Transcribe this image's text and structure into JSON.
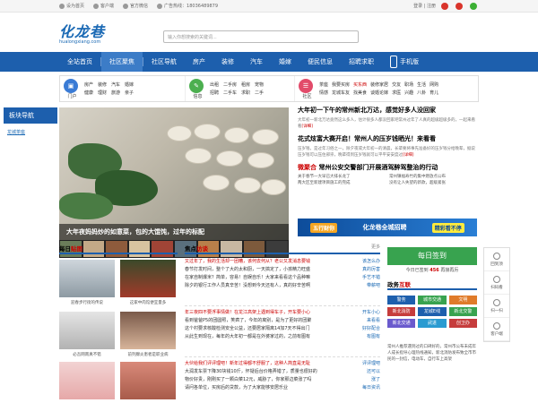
{
  "topbar": {
    "set_home": "设为首页",
    "client": "客户端",
    "wechat": "官方微信",
    "ad_hotline": "广告热线：18036489879",
    "login": "登录 | 注册"
  },
  "header": {
    "logo_text": "化龙巷",
    "logo_sub": "hualongxiang.com",
    "search_placeholder": "输入你想搜索的关键词..."
  },
  "nav": {
    "items": [
      "全站首页",
      "社区聚焦",
      "社区导航",
      "房产",
      "装修",
      "汽车",
      "婚嫁",
      "便民信息",
      "招聘求职",
      "手机版"
    ]
  },
  "categories": {
    "menhu": {
      "label": "门户",
      "links": [
        "房产",
        "装修",
        "汽车",
        "婚嫁",
        "健康",
        "理财",
        "旅游",
        "亲子"
      ]
    },
    "xinxi": {
      "label": "信息",
      "links": [
        "出租",
        "二手房",
        "租房",
        "宠物",
        "招聘",
        "二手车",
        "求职",
        "二手"
      ]
    },
    "shequ": {
      "label": "社区",
      "links": [
        "茶座",
        "我要买房",
        "买东西",
        "装修家居",
        "交友",
        "职场",
        "生活",
        "网购",
        "情感",
        "龙城车友",
        "找美食",
        "谈婚论嫁",
        "求医",
        "兴趣",
        "八卦",
        "育儿"
      ]
    }
  },
  "sidebar": {
    "title": "板块导航",
    "link": "龙城茶座"
  },
  "feature": {
    "caption": "大年夜妈妈炒的如意菜，包的大馄饨，过年的标配"
  },
  "news": {
    "headline1": "大年初一下午的常州新北万达，感觉好多人没回家",
    "para1": "大年初一新北万达竟然这么多人，估计很多人都没回家吧常州过年了人真的超级超级多的，一起来看看",
    "detail1": "[详细]",
    "headline2": "花式炫富大赛开启！常州人的压岁钱晒光！来看看",
    "para2": "压岁钱，是过年习俗之一，除夕夜或大年初一的清晨，长辈要将事先准备好的压岁钱分给晚辈，据说压岁钱可以压住邪祟，晚辈得到压岁钱就可以平平安安度过",
    "detail2": "[详细]",
    "tag3": "微聚合",
    "headline3": "常州公安交警部门开展酒驾醉驾整治的行动",
    "sub": [
      "关于春节一大早已大排长龙了",
      "常州镇福寿竹的集中燃放点公布",
      "两大区至新建项目施工的完成",
      "没有让人失望的新款，超级紧张"
    ]
  },
  "banner": {
    "left": "五行财你",
    "mid": "化龙巷全城招聘",
    "right": "精彩看不停"
  },
  "daily_photo": {
    "title_prefix": "每日",
    "title_hl": "贴图",
    "items": [
      {
        "caption": "迎春步行街的传说"
      },
      {
        "caption": "这家中肉馆便宜量多"
      },
      {
        "caption": "必吾网南真不错"
      },
      {
        "caption": "前列腺炎患者是职业病"
      }
    ]
  },
  "focus": {
    "title_prefix": "焦点",
    "title_hl": "访谈",
    "more": "更多",
    "groups": [
      [
        {
          "text": "又过年了，我的生活却一团糟，该何去何从？老公又发消息要钱",
          "right": "该怎么办",
          "red": true
        },
        {
          "text": "春节打发时间，整个了大的太和厨，一天搞定了，小孩精力旺盛",
          "right": "真的厉害"
        },
        {
          "text": "在家自制爆米？简单，容易！自娱自乐！大家来看看这个品种嘛",
          "right": "手艺不错"
        },
        {
          "text": "除夕的银行工作人员真辛苦！没想到今天还有人，真的好辛苦啊",
          "right": "带薪吧"
        }
      ],
      [
        {
          "text": "年三夜四不要浮事情做！在龙江高架上遇到得车子，开车要小心",
          "right": "开车小心",
          "red": true
        },
        {
          "text": "看到爸爸P5的团圆照，笑疯了，今年的离别，是为了更好的团聚",
          "right": "来看看"
        },
        {
          "text": "这个村要求核酸检测安全公益，还要居家隔离14加7天不得出门",
          "right": "好好配合"
        },
        {
          "text": "从此生到现在，每年的大年初一都是在外婆家过的，之前有图有",
          "right": "有图有"
        }
      ],
      [
        {
          "text": "大伙给我们评评理吧！新年过得都不舒服了，这种人简直是无耻",
          "right": "评评理吧",
          "red": true
        },
        {
          "text": "大润发车票下降30块钱10斤，怀疑后台价格弄错了，质量也很好的",
          "right": "还可以"
        },
        {
          "text": "物价好贵，刚刚买了一颗白菜12元，威胁了，你家那边菜涨了吗",
          "right": "涨了"
        },
        {
          "text": "请问各单位，买房后的贷款，为了大家能够安居乐业",
          "right": "每日资讯"
        }
      ]
    ]
  },
  "sign": {
    "button": "每日签到",
    "info_prefix": "今日已签到",
    "count": "456",
    "info_suffix": "再接再厉"
  },
  "zhengwu": {
    "title_prefix": "政务",
    "title_hl": "互联",
    "items": [
      "警务",
      "城市交通",
      "文明",
      "新北消防",
      "龙城E线",
      "新北交警",
      "新北交通",
      "武进",
      "创卫办"
    ],
    "text": "常州人推荐遇到过的口碑好的，常州市公布未成年人成长指导心理热线通知，新北消防发布致全市市民的一封信，电动车，自行车上高架"
  },
  "float": {
    "items": [
      "回到顶",
      "扫码看",
      "扫一扫",
      "客户端"
    ]
  },
  "colors": {
    "nav": "#1d5fad",
    "accent_red": "#cc0000",
    "sign_green": "#38a34f"
  }
}
